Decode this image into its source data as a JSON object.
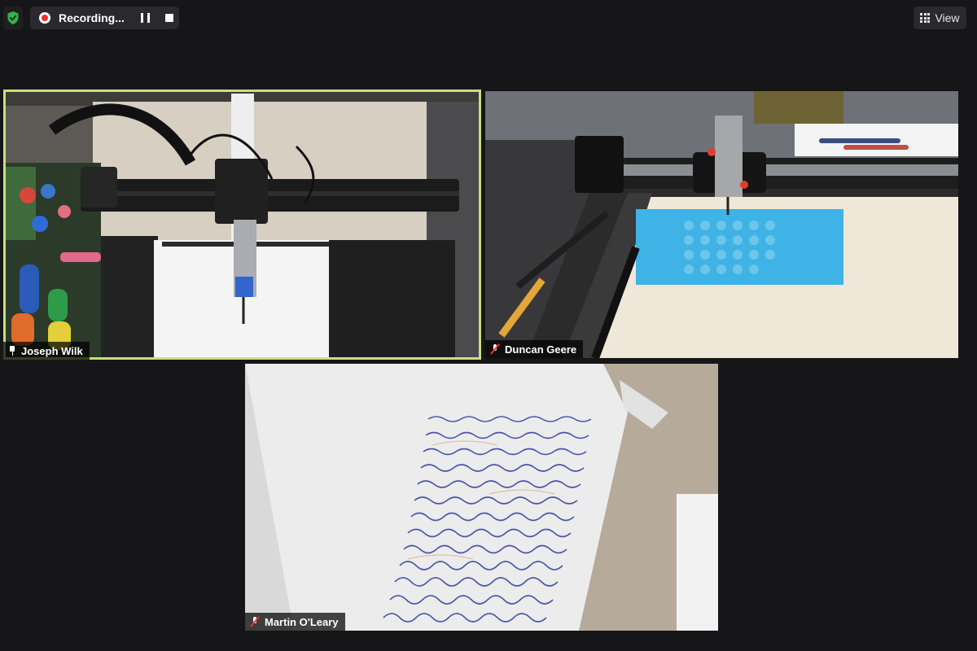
{
  "toolbar": {
    "recording_label": "Recording...",
    "view_label": "View",
    "shield_icon": "shield-check-icon",
    "colors": {
      "recording": "#e5312f",
      "shield": "#33b34a",
      "active_speaker": "#c9df7c"
    }
  },
  "participants": [
    {
      "name": "Joseph Wilk",
      "status_icon": "pin-icon",
      "active_speaker": true
    },
    {
      "name": "Duncan Geere",
      "status_icon": "mic-off-icon",
      "active_speaker": false
    },
    {
      "name": "Martin O'Leary",
      "status_icon": "mic-off-icon",
      "active_speaker": false
    }
  ]
}
